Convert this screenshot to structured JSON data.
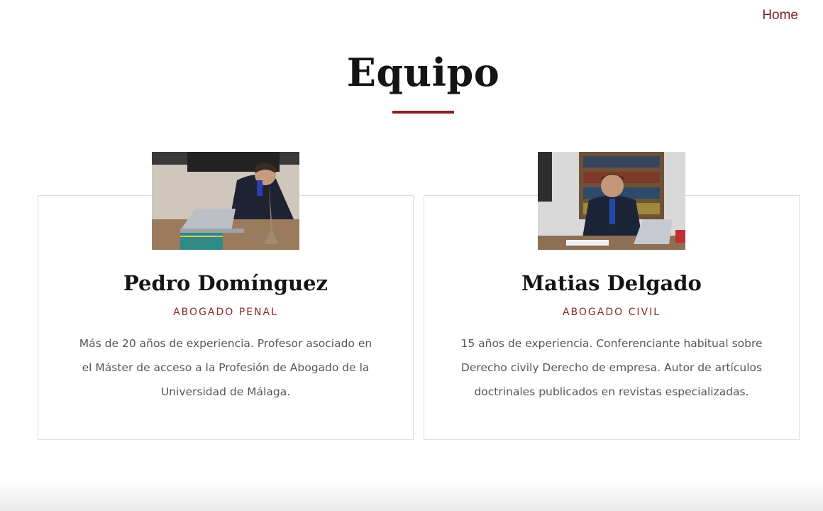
{
  "nav": {
    "home_label": "Home"
  },
  "section": {
    "title": "Equipo",
    "accent_color": "#8a1f24"
  },
  "team": [
    {
      "name": "Pedro Domínguez",
      "role": "ABOGADO PENAL",
      "bio": "Más de 20 años de experiencia.  Profesor asociado en el Máster de acceso a la  Profesión de Abogado de la Universidad de  Málaga."
    },
    {
      "name": "Matias Delgado",
      "role": "ABOGADO CIVIL",
      "bio": "15 años de experiencia. Conferenciante habitual sobre Derecho civily  Derecho de empresa. Autor de artículos doctrinales publicados en revistas especializadas."
    }
  ]
}
